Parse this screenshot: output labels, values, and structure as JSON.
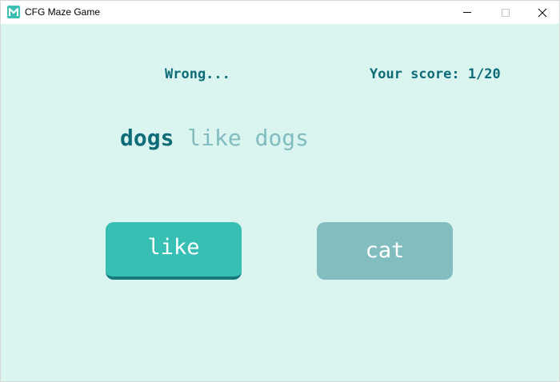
{
  "window": {
    "title": "CFG Maze Game",
    "app_icon": "maze-app-icon",
    "controls": {
      "minimize_icon": "minimize-icon",
      "maximize_icon": "maximize-icon",
      "close_icon": "close-icon"
    }
  },
  "game": {
    "status": "Wrong...",
    "score": "Your score: 1/20",
    "sentence": {
      "current_word": "dogs",
      "remaining": "like dogs"
    },
    "choices": [
      {
        "label": "like",
        "state": "active"
      },
      {
        "label": "cat",
        "state": "inactive"
      }
    ]
  },
  "colors": {
    "background": "#daf4ef",
    "text_dark": "#0e6b78",
    "text_faded": "#80bcc0",
    "button_active": "#36bfb2",
    "button_active_shadow": "#15797d",
    "button_inactive": "#82bec0"
  }
}
